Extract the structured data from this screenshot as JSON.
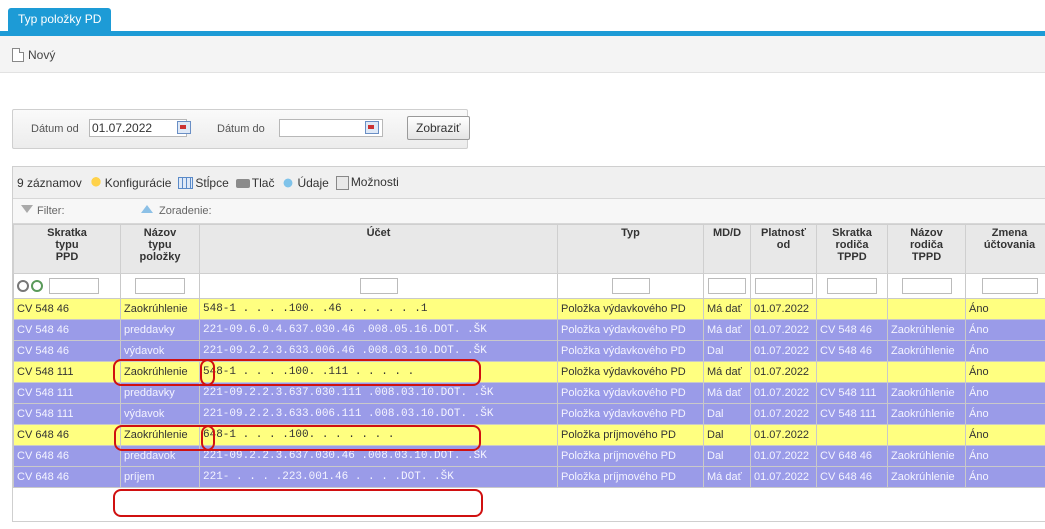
{
  "tab": {
    "label": "Typ položky PD"
  },
  "toolbar": {
    "new_label": "Nový"
  },
  "filter": {
    "date_from_label": "Dátum od",
    "date_from_value": "01.07.2022",
    "date_to_label": "Dátum do",
    "date_to_value": "",
    "show_button": "Zobraziť"
  },
  "grid": {
    "record_count": "9 záznamov",
    "tools": [
      "Konfigurácie",
      "Stĺpce",
      "Tlač",
      "Údaje",
      "Možnosti"
    ],
    "filter_label": "Filter:",
    "sort_label": "Zoradenie:",
    "columns": [
      [
        "Skratka",
        "typu",
        "PPD"
      ],
      [
        "Názov",
        "typu",
        "položky"
      ],
      [
        "Účet"
      ],
      [
        "Typ"
      ],
      [
        "MD/D"
      ],
      [
        "Platnosť",
        "od"
      ],
      [
        "Skratka",
        "rodiča",
        "TPPD"
      ],
      [
        "Názov",
        "rodiča",
        "TPPD"
      ],
      [
        "Zmena",
        "účtovania"
      ]
    ],
    "rows": [
      {
        "style": "yel",
        "cells": [
          "CV 548 46",
          "Zaokrúhlenie",
          "548-1    .    .    . .100.     .46      .    .    .    .    .    .1",
          "Položka výdavkového PD",
          "Má dať",
          "01.07.2022",
          "",
          "",
          "Áno"
        ]
      },
      {
        "style": "pur",
        "cells": [
          "CV 548 46",
          "preddavky",
          "221-09.6.0.4.637.030.46   .008.05.16.DOT.  .ŠK",
          "Položka výdavkového PD",
          "Má dať",
          "01.07.2022",
          "CV 548 46",
          "Zaokrúhlenie",
          "Áno"
        ]
      },
      {
        "style": "pur",
        "cells": [
          "CV 548 46",
          "výdavok",
          "221-09.2.2.3.633.006.46   .008.03.10.DOT.  .ŠK",
          "Položka výdavkového PD",
          "Dal",
          "01.07.2022",
          "CV 548 46",
          "Zaokrúhlenie",
          "Áno"
        ]
      },
      {
        "style": "yel",
        "cells": [
          "CV 548 111",
          "Zaokrúhlenie",
          "548-1    .    .    . .100.     .111      .    .    .    .    .",
          "Položka výdavkového PD",
          "Má dať",
          "01.07.2022",
          "",
          "",
          "Áno"
        ]
      },
      {
        "style": "pur",
        "cells": [
          "CV 548 111",
          "preddavky",
          "221-09.2.2.3.637.030.111 .008.03.10.DOT.  .ŠK",
          "Položka výdavkového PD",
          "Má dať",
          "01.07.2022",
          "CV 548 111",
          "Zaokrúhlenie",
          "Áno"
        ]
      },
      {
        "style": "pur",
        "cells": [
          "CV 548 111",
          "výdavok",
          "221-09.2.2.3.633.006.111 .008.03.10.DOT.  .ŠK",
          "Položka výdavkového PD",
          "Dal",
          "01.07.2022",
          "CV 548 111",
          "Zaokrúhlenie",
          "Áno"
        ]
      },
      {
        "style": "yel",
        "cells": [
          "CV 648 46",
          "Zaokrúhlenie",
          "648-1    .    .    . .100.     .      .    .    .    .    .",
          "Položka príjmového PD",
          "Dal",
          "01.07.2022",
          "",
          "",
          "Áno"
        ]
      },
      {
        "style": "pur",
        "cells": [
          "CV 648 46",
          "preddavok",
          "221-09.2.2.3.637.030.46   .008.03.10.DOT.  .ŠK",
          "Položka príjmového PD",
          "Dal",
          "01.07.2022",
          "CV 648 46",
          "Zaokrúhlenie",
          "Áno"
        ]
      },
      {
        "style": "pur",
        "cells": [
          "CV 648 46",
          "príjem",
          "221-    .    .    . .223.001.46      .    .    .    .DOT.  .ŠK",
          "Položka príjmového PD",
          "Má dať",
          "01.07.2022",
          "CV 648 46",
          "Zaokrúhlenie",
          "Áno"
        ]
      }
    ]
  }
}
